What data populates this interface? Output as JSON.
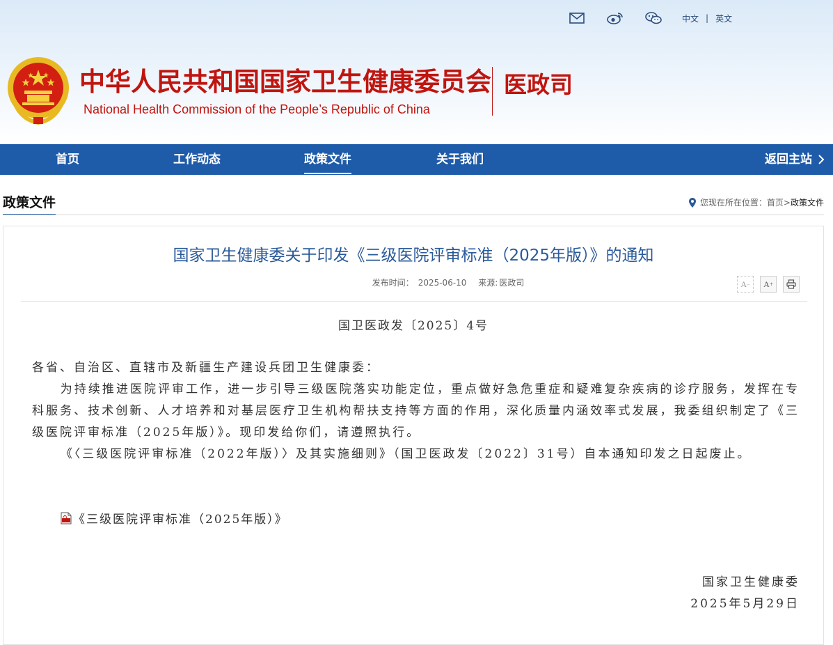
{
  "topbar": {
    "icons": [
      "mail-icon",
      "weibo-icon",
      "wechat-icon"
    ],
    "lang_zh": "中文",
    "separator": "|",
    "lang_en": "英文"
  },
  "header": {
    "site_title": "中华人民共和国国家卫生健康委员会",
    "site_title_en": "National Health Commission of the People’s  Republic of China",
    "department": "医政司"
  },
  "nav": {
    "items": [
      {
        "label": "首页"
      },
      {
        "label": "工作动态"
      },
      {
        "label": "政策文件",
        "active": true
      },
      {
        "label": "关于我们"
      }
    ],
    "back_label": "返回主站"
  },
  "section": {
    "title": "政策文件",
    "breadcrumb_prefix": "您现在所在位置：",
    "breadcrumb_home": "首页",
    "breadcrumb_sep": ">",
    "breadcrumb_current": "政策文件"
  },
  "article": {
    "title": "国家卫生健康委关于印发《三级医院评审标准（2025年版）》的通知",
    "meta_date_label": "发布时间：",
    "meta_date": "2025-06-10",
    "meta_source_label": "来源:",
    "meta_source": "医政司",
    "tools": {
      "font_smaller": "A",
      "font_larger": "A",
      "plus": "+",
      "minus": "−"
    },
    "doc_number": "国卫医政发〔2025〕4号",
    "salutation": "各省、自治区、直辖市及新疆生产建设兵团卫生健康委：",
    "paragraph_1": "为持续推进医院评审工作，进一步引导三级医院落实功能定位，重点做好急危重症和疑难复杂疾病的诊疗服务，发挥在专科服务、技术创新、人才培养和对基层医疗卫生机构帮扶支持等方面的作用，深化质量内涵效率式发展，我委组织制定了《三级医院评审标准（2025年版）》。现印发给你们，请遵照执行。",
    "paragraph_2": "《〈三级医院评审标准（2022年版）〉及其实施细则》（国卫医政发〔2022〕31号）自本通知印发之日起废止。",
    "attachment": "《三级医院评审标准（2025年版）》",
    "signature_org": "国家卫生健康委",
    "signature_date": "2025年5月29日"
  },
  "colors": {
    "brand_red": "#c0150f",
    "nav_blue": "#1e5ba9",
    "title_blue": "#2a5a9a"
  }
}
